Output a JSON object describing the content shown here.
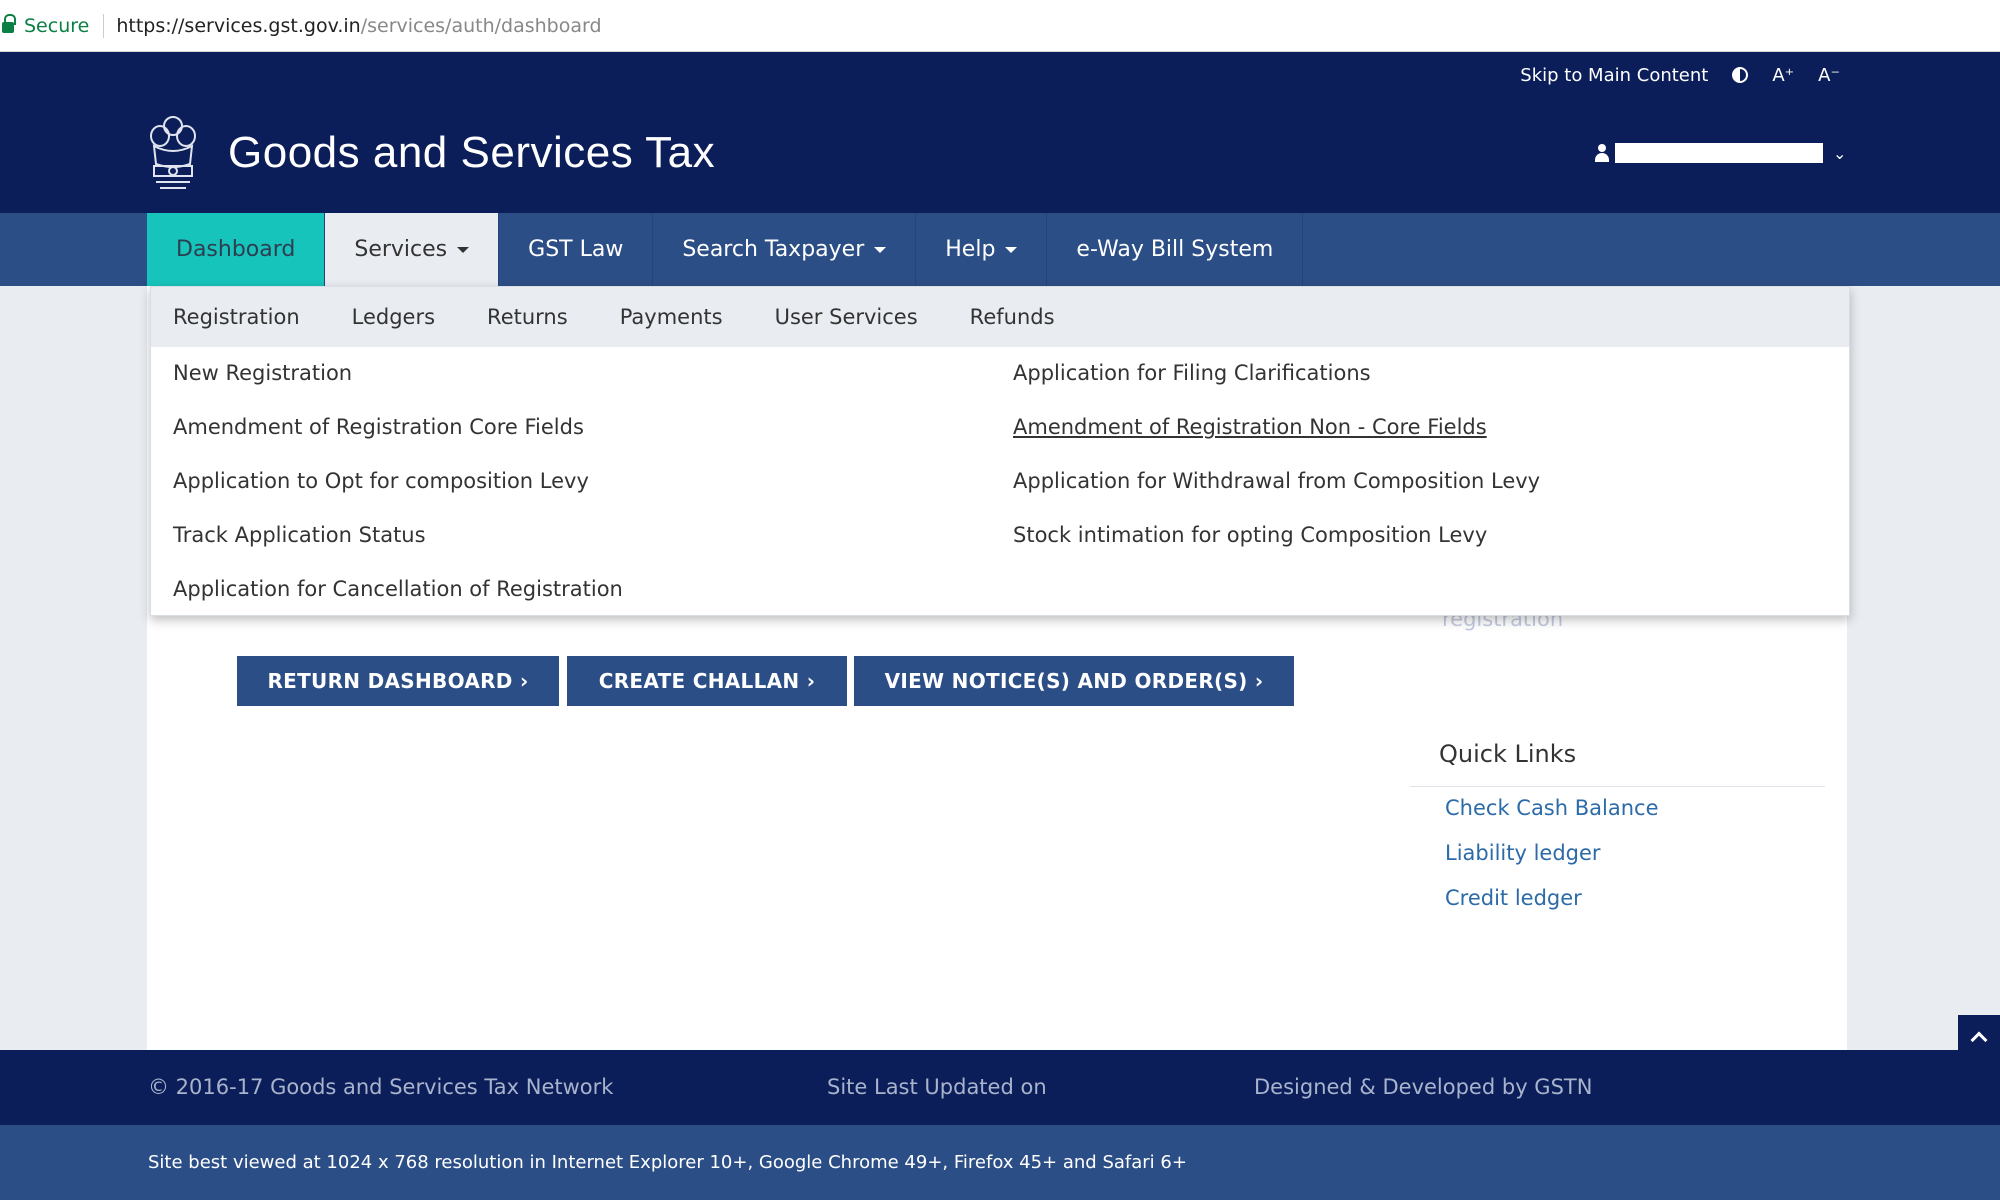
{
  "browser": {
    "secure_label": "Secure",
    "url_host": "https://services.gst.gov.in",
    "url_path": "/services/auth/dashboard"
  },
  "utility": {
    "skip_label": "Skip to Main Content",
    "font_increase": "A⁺",
    "font_decrease": "A⁻"
  },
  "header": {
    "title": "Goods and Services Tax"
  },
  "nav": {
    "items": [
      {
        "label": "Dashboard"
      },
      {
        "label": "Services"
      },
      {
        "label": "GST Law"
      },
      {
        "label": "Search Taxpayer"
      },
      {
        "label": "Help"
      },
      {
        "label": "e-Way Bill System"
      }
    ]
  },
  "services_menu": {
    "tabs": [
      "Registration",
      "Ledgers",
      "Returns",
      "Payments",
      "User Services",
      "Refunds"
    ],
    "left_links": [
      "New Registration",
      "Amendment of Registration Core Fields",
      "Application to Opt for composition Levy",
      "Track Application Status",
      "Application for Cancellation of Registration"
    ],
    "right_links": [
      "Application for Filing Clarifications",
      "Amendment of Registration Non - Core Fields",
      "Application for Withdrawal from Composition Levy",
      "Stock intimation for opting Composition Levy"
    ]
  },
  "content": {
    "ghost_text": "registration",
    "buttons": {
      "return_dashboard": "RETURN DASHBOARD ›",
      "create_challan": "CREATE CHALLAN ›",
      "view_notices": "VIEW NOTICE(S) AND ORDER(S) ›"
    },
    "quick_links": {
      "title": "Quick Links",
      "items": [
        "Check Cash Balance",
        "Liability ledger",
        "Credit ledger"
      ]
    }
  },
  "footer": {
    "copyright": "© 2016-17 Goods and Services Tax Network",
    "last_updated": "Site Last Updated on",
    "designed_by": "Designed & Developed by GSTN",
    "best_viewed": "Site best viewed at 1024 x 768 resolution in Internet Explorer 10+, Google Chrome 49+, Firefox 45+ and Safari 6+"
  },
  "colors": {
    "header_navy": "#0b1e59",
    "nav_blue": "#2c4e86",
    "active_teal": "#17c4bb",
    "link_blue": "#2c6aa8"
  }
}
